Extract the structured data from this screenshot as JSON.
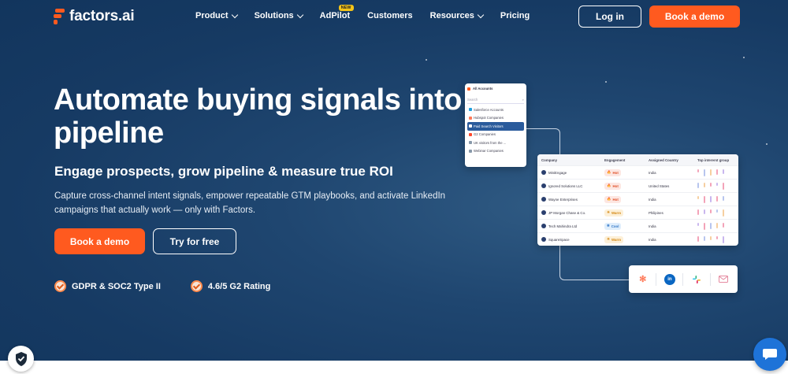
{
  "brand": {
    "name": "factors.ai",
    "accent_color": "#ff5a1f"
  },
  "nav": {
    "items": [
      {
        "label": "Product",
        "has_dropdown": true
      },
      {
        "label": "Solutions",
        "has_dropdown": true
      },
      {
        "label": "AdPilot",
        "has_dropdown": false,
        "badge": "NEW"
      },
      {
        "label": "Customers",
        "has_dropdown": false
      },
      {
        "label": "Resources",
        "has_dropdown": true
      },
      {
        "label": "Pricing",
        "has_dropdown": false
      }
    ],
    "login_label": "Log in",
    "demo_label": "Book a demo"
  },
  "hero": {
    "title": "Automate buying signals into pipeline",
    "subtitle": "Engage prospects, grow pipeline & measure true ROI",
    "description": "Capture cross-channel intent signals, empower repeatable GTM playbooks, and activate LinkedIn campaigns that actually work — only with Factors.",
    "cta_primary": "Book a demo",
    "cta_secondary": "Try for free",
    "badges": [
      "GDPR & SOC2 Type II",
      "4.6/5 G2 Rating"
    ]
  },
  "accounts_card": {
    "title": "All Accounts",
    "search_placeholder": "Search",
    "items": [
      {
        "label": "Salesforce Accounts",
        "active": false,
        "color": "#1ea0e0"
      },
      {
        "label": "Hubspot Companies",
        "active": false,
        "color": "#ff7a59"
      },
      {
        "label": "Paid Search Visitors",
        "active": true,
        "color": "#ffffff"
      },
      {
        "label": "G2 Companies",
        "active": false,
        "color": "#ff492c"
      },
      {
        "label": "UK visitors from the ...",
        "active": false,
        "color": "#8899aa"
      },
      {
        "label": "Webinar Companies",
        "active": false,
        "color": "#8899aa"
      }
    ]
  },
  "table_card": {
    "columns": [
      "Company",
      "Engagement",
      "Assigned Country",
      "Top intererst group"
    ],
    "rows": [
      {
        "company": "MiniEngage",
        "engagement": "Hot",
        "level": "hot",
        "country": "India"
      },
      {
        "company": "Ignored Solutions LLC",
        "engagement": "Hot",
        "level": "hot",
        "country": "United States"
      },
      {
        "company": "Wayne Enterprises",
        "engagement": "Hot",
        "level": "hot",
        "country": "India"
      },
      {
        "company": "JP Morgan Chase & Co.",
        "engagement": "Warm",
        "level": "warm",
        "country": "Philipines"
      },
      {
        "company": "Tech Mahindra Ltd",
        "engagement": "Cool",
        "level": "cool",
        "country": "India"
      },
      {
        "company": "SquareSpace",
        "engagement": "Warm",
        "level": "warm",
        "country": "India"
      }
    ]
  },
  "integrations": [
    "hubspot-icon",
    "linkedin-icon",
    "slack-icon",
    "email-icon"
  ]
}
